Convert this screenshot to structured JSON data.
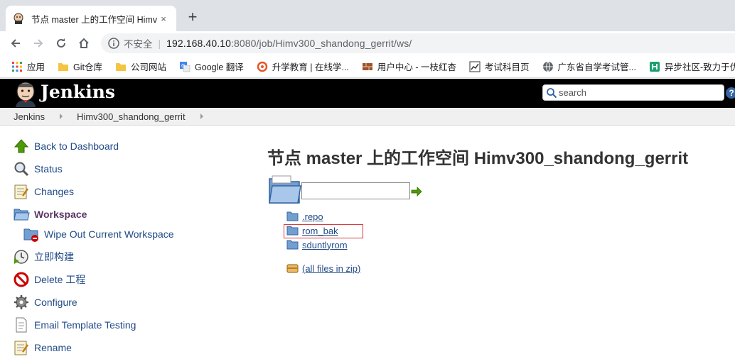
{
  "browser": {
    "tab_title": "节点 master 上的工作空间 Himv",
    "tab_close": "×",
    "new_tab": "+",
    "security_label": "不安全",
    "url_host": "192.168.40.10",
    "url_rest": ":8080/job/Himv300_shandong_gerrit/ws/"
  },
  "bookmarks": [
    {
      "label": "应用",
      "icon": "apps-grid-icon"
    },
    {
      "label": "Git仓库",
      "icon": "bookmark-folder-icon"
    },
    {
      "label": "公司网站",
      "icon": "bookmark-folder-icon"
    },
    {
      "label": "Google 翻译",
      "icon": "google-translate-icon"
    },
    {
      "label": "升学教育 | 在线学...",
      "icon": "swirl-icon"
    },
    {
      "label": "用户中心 - 一枝红杏",
      "icon": "brick-icon"
    },
    {
      "label": "考试科目页",
      "icon": "chart-icon"
    },
    {
      "label": "广东省自学考试管...",
      "icon": "globe-icon"
    },
    {
      "label": "异步社区-致力于优",
      "icon": "community-icon"
    }
  ],
  "jenkins": {
    "title": "Jenkins",
    "search_placeholder": "search",
    "help": "?"
  },
  "breadcrumb": [
    "Jenkins",
    "Himv300_shandong_gerrit"
  ],
  "tasks": [
    {
      "label": "Back to Dashboard"
    },
    {
      "label": "Status"
    },
    {
      "label": "Changes"
    },
    {
      "label": "Workspace"
    },
    {
      "label": "Wipe Out Current Workspace"
    },
    {
      "label": "立即构建"
    },
    {
      "label": "Delete 工程"
    },
    {
      "label": "Configure"
    },
    {
      "label": "Email Template Testing"
    },
    {
      "label": "Rename"
    }
  ],
  "main": {
    "title": "节点 master 上的工作空间 Himv300_shandong_gerrit",
    "path_value": "",
    "files": [
      ".repo",
      "rom_bak",
      "sduntlyrom"
    ],
    "zip_label": "(all files in zip)"
  },
  "colors": {
    "link": "#204a87",
    "highlight": "#d33c3c",
    "header_bg": "#000000"
  }
}
